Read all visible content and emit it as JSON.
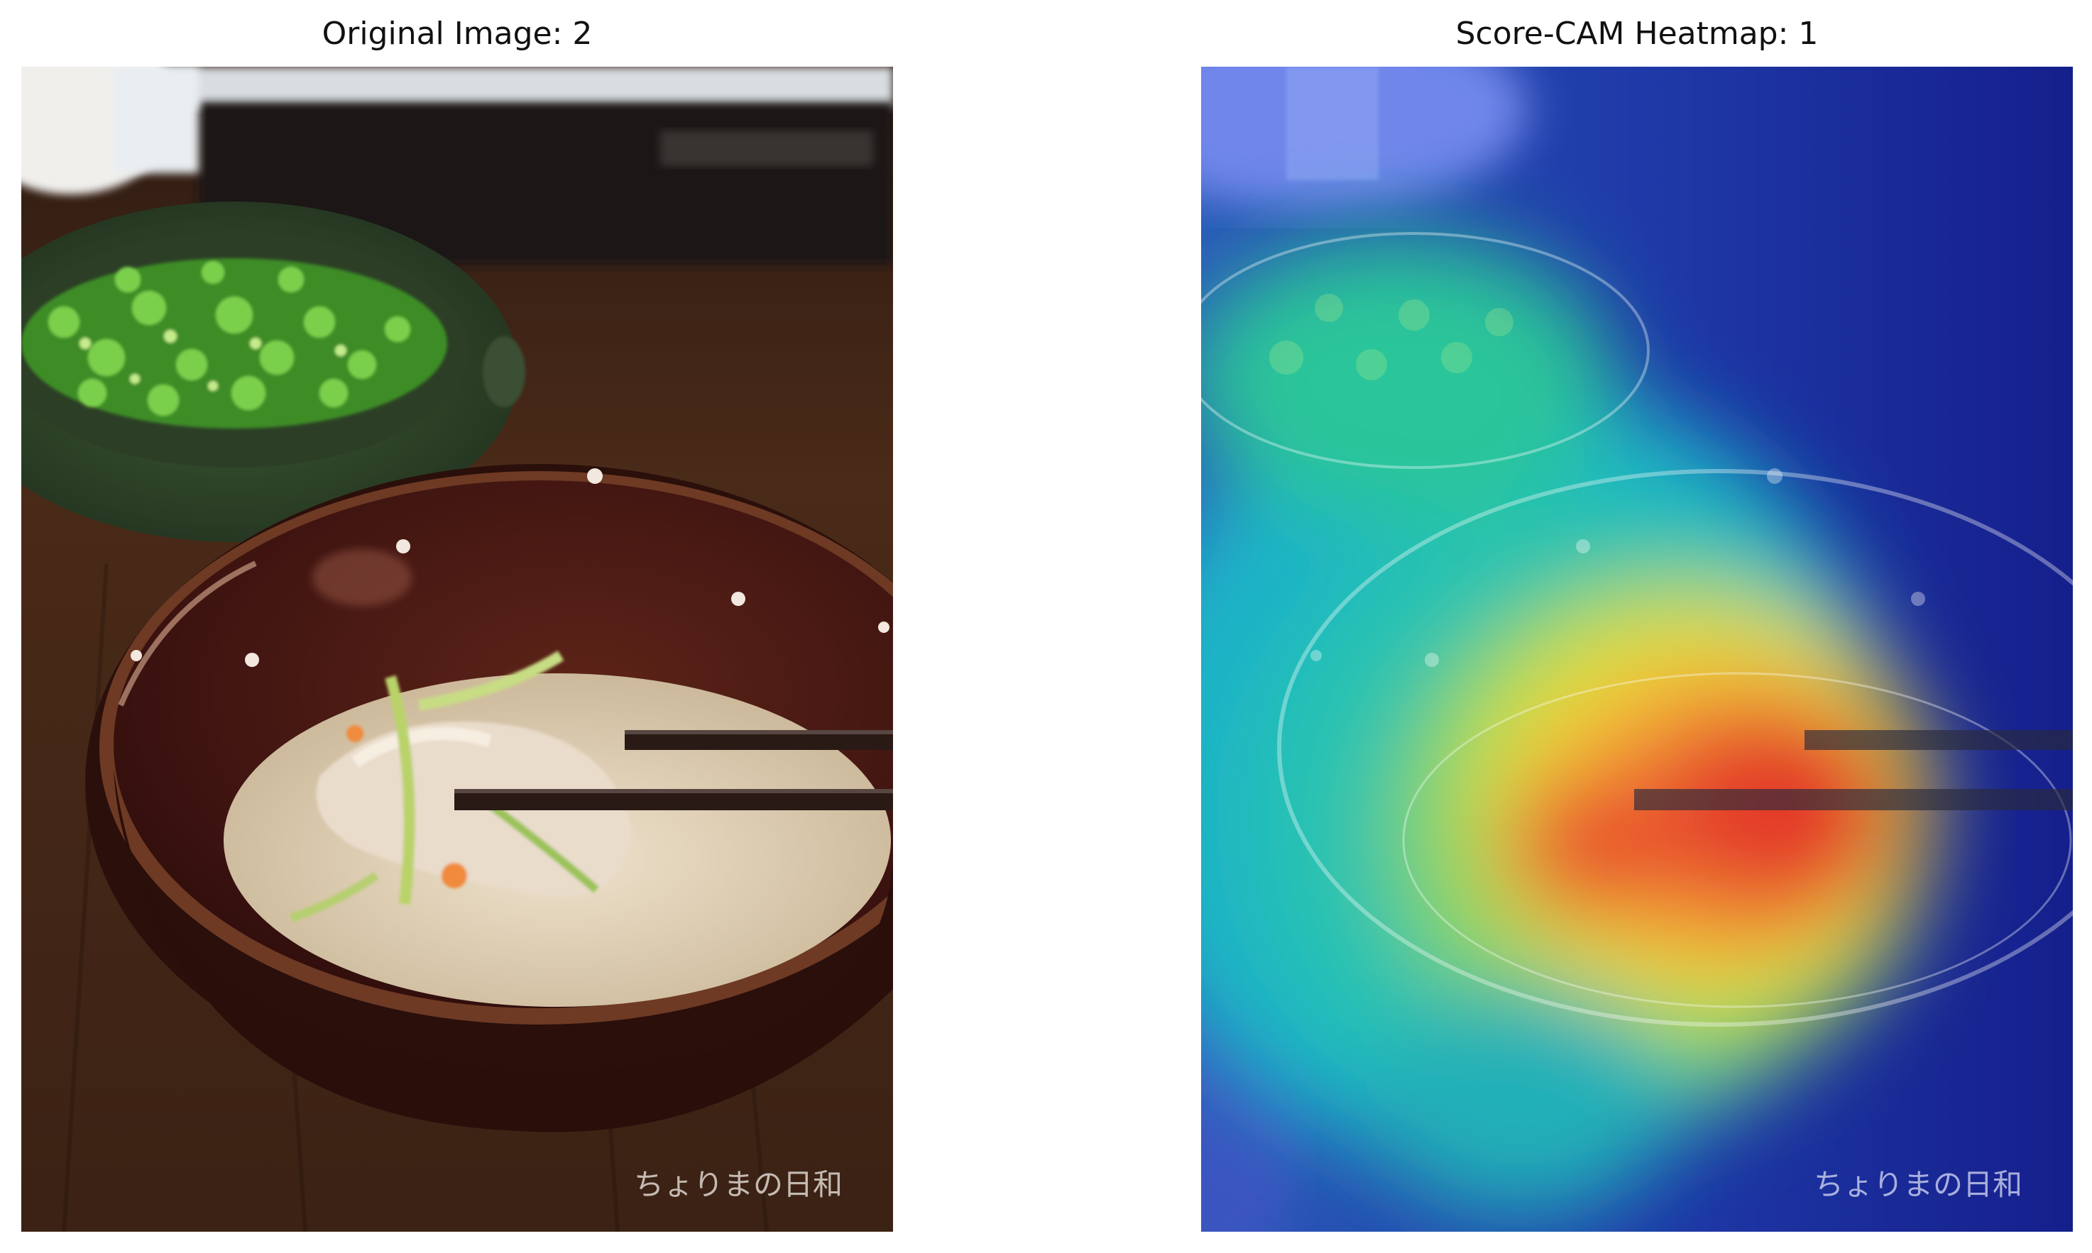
{
  "figure": {
    "left_panel": {
      "title": "Original Image: 2",
      "watermark": "ちょりまの日和"
    },
    "right_panel": {
      "title": "Score-CAM Heatmap: 1",
      "watermark": "ちょりまの日和"
    }
  },
  "colors": {
    "table_wood": "#4a2a18",
    "bowl_glaze": "#4a1712",
    "soup": "#d9c9ad",
    "scallion": "#5cc23a",
    "heat_low": "#1b2fa8",
    "heat_high": "#e8352a"
  }
}
